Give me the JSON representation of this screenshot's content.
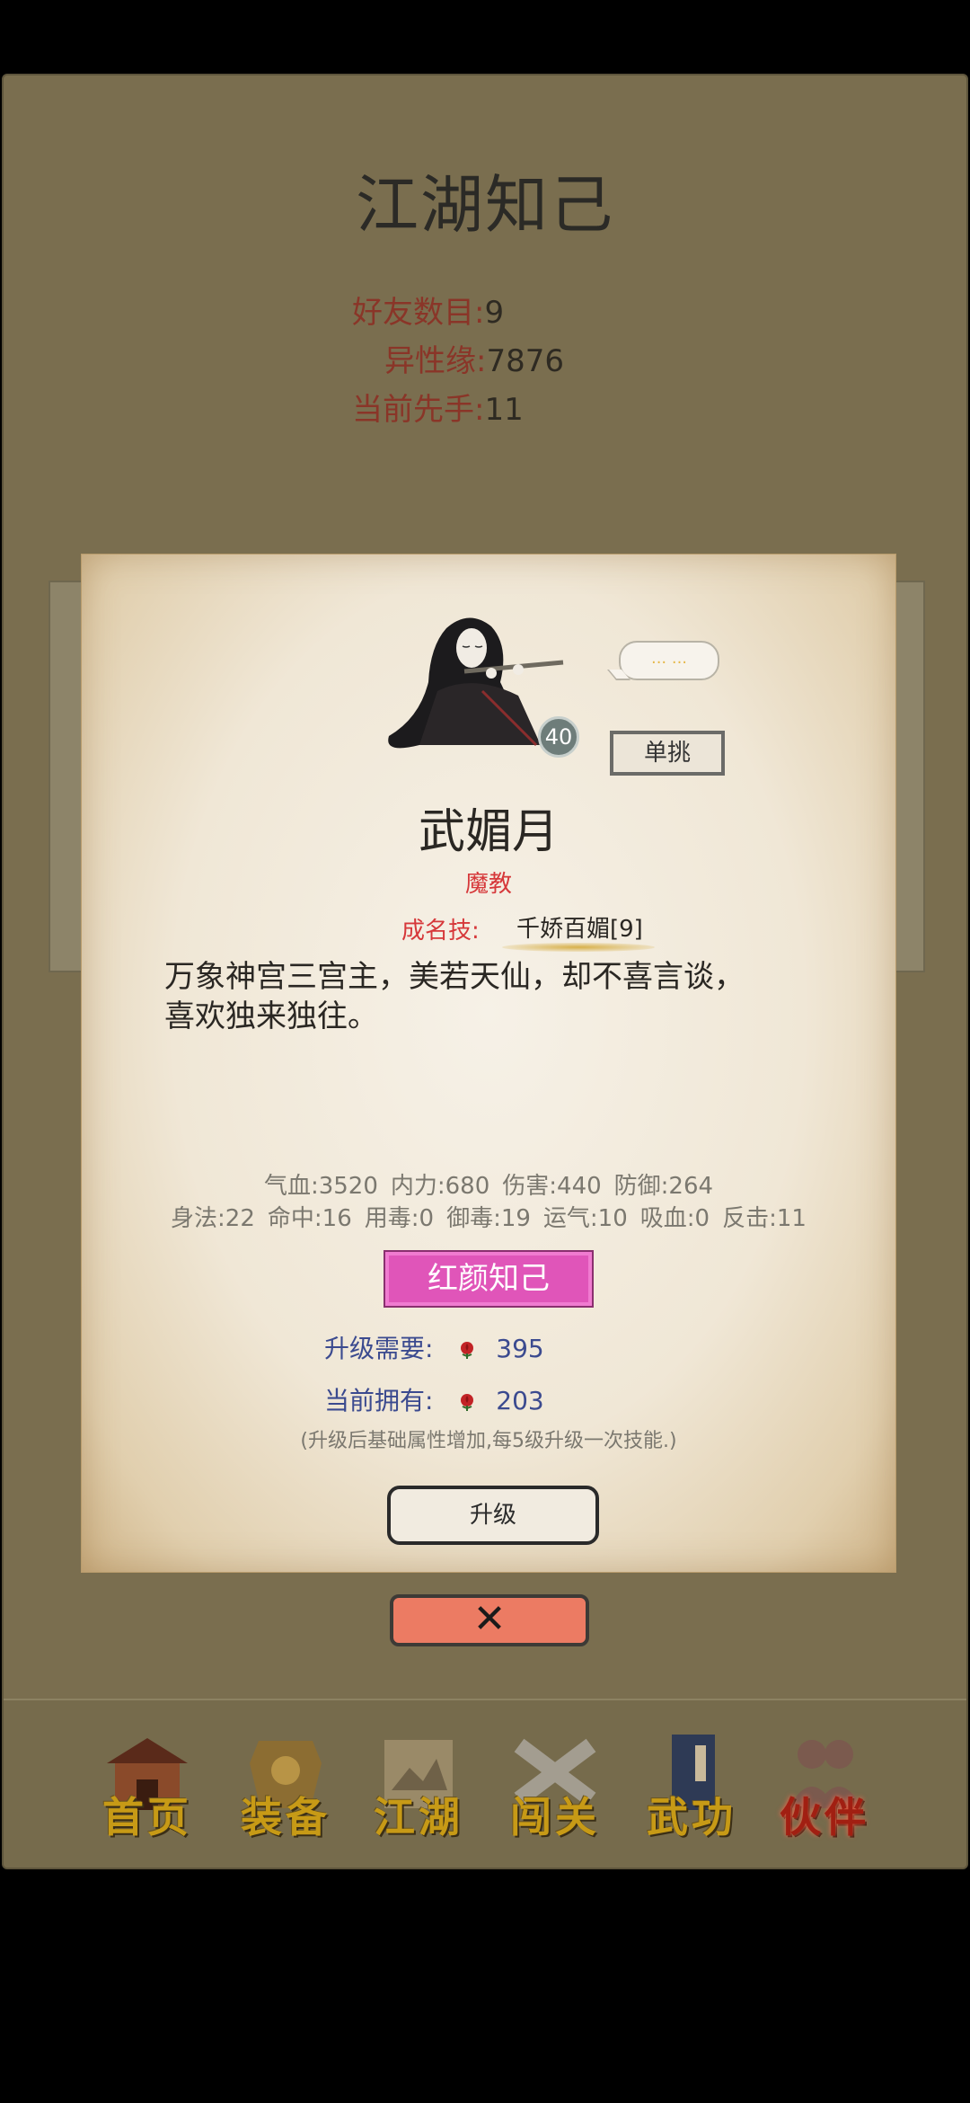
{
  "page": {
    "title": "江湖知己",
    "stats": [
      {
        "label": "好友数目",
        "value": "9"
      },
      {
        "label": "异性缘",
        "value": "7876"
      },
      {
        "label": "当前先手",
        "value": "11"
      }
    ]
  },
  "card": {
    "level": "40",
    "speech": "... ...",
    "duel_button": "单挑",
    "name": "武媚月",
    "faction": "魔教",
    "skill_label": "成名技:",
    "skill_value": "千娇百媚[9]",
    "description_line1": "万象神宫三宫主，美若天仙，却不喜言谈，",
    "description_line2": "喜欢独来独往。",
    "attrs_row1": [
      "气血:3520",
      "内力:680",
      "伤害:440",
      "防御:264"
    ],
    "attrs_row2": [
      "身法:22",
      "命中:16",
      "用毒:0",
      "御毒:19",
      "运气:10",
      "吸血:0",
      "反击:11"
    ],
    "relation_button": "红颜知己",
    "upgrade_need_label": "升级需要:",
    "upgrade_need_value": "395",
    "current_have_label": "当前拥有:",
    "current_have_value": "203",
    "note": "(升级后基础属性增加,每5级升级一次技能.)",
    "upgrade_button": "升级"
  },
  "close_button": "✕",
  "nav": [
    {
      "label": "首页",
      "icon": "building-icon"
    },
    {
      "label": "装备",
      "icon": "armor-icon"
    },
    {
      "label": "江湖",
      "icon": "scroll-icon"
    },
    {
      "label": "闯关",
      "icon": "crossed-swords-icon"
    },
    {
      "label": "武功",
      "icon": "book-icon"
    },
    {
      "label": "伙伴",
      "icon": "partners-icon",
      "active": true
    }
  ],
  "colors": {
    "background": "#7a6e4f",
    "label_red": "#8a3528",
    "accent_pink": "#e055b9",
    "close_salmon": "#ec7b63",
    "nav_gold": "#c79a16"
  }
}
